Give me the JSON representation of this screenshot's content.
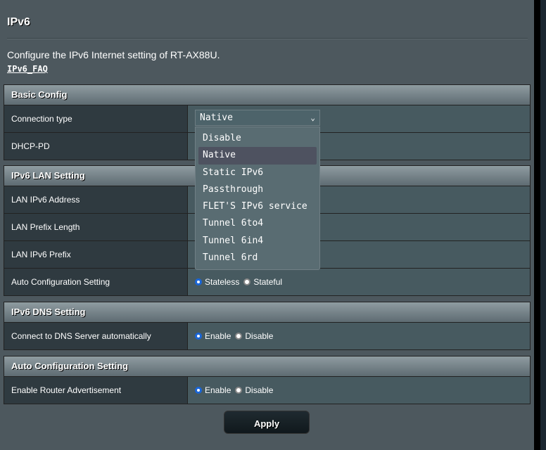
{
  "page": {
    "title": "IPv6",
    "description": "Configure the IPv6 Internet setting of RT-AX88U.",
    "faq_link": "IPv6_FAQ"
  },
  "sections": {
    "basic": {
      "title": "Basic Config",
      "connection_type_label": "Connection type",
      "connection_type_value": "Native",
      "dhcp_pd_label": "DHCP-PD"
    },
    "lan": {
      "title": "IPv6 LAN Setting",
      "lan_ipv6_address_label": "LAN IPv6 Address",
      "lan_prefix_length_label": "LAN Prefix Length",
      "lan_ipv6_prefix_label": "LAN IPv6 Prefix",
      "auto_config_label": "Auto Configuration Setting",
      "auto_config_options": [
        "Stateless",
        "Stateful"
      ],
      "auto_config_selected": "Stateless"
    },
    "dns": {
      "title": "IPv6 DNS Setting",
      "connect_dns_label": "Connect to DNS Server automatically",
      "options": [
        "Enable",
        "Disable"
      ],
      "selected": "Enable"
    },
    "autoconf": {
      "title": "Auto Configuration Setting",
      "router_adv_label": "Enable Router Advertisement",
      "options": [
        "Enable",
        "Disable"
      ],
      "selected": "Enable"
    }
  },
  "dropdown": {
    "options": [
      "Disable",
      "Native",
      "Static IPv6",
      "Passthrough",
      "FLET'S IPv6 service",
      "Tunnel 6to4",
      "Tunnel 6in4",
      "Tunnel 6rd"
    ],
    "highlighted": "Native"
  },
  "apply_label": "Apply",
  "icons": {
    "chevron": "chevron-down-icon"
  }
}
